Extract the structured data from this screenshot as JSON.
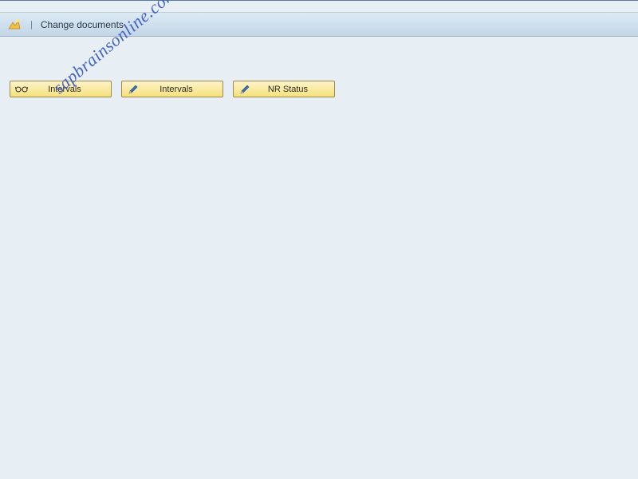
{
  "toolbar": {
    "title": "Change documents"
  },
  "buttons": {
    "display_intervals": {
      "label": "Intervals"
    },
    "change_intervals": {
      "label": "Intervals"
    },
    "nr_status": {
      "label": "NR Status"
    }
  },
  "watermark": "sapbrainsonline.com"
}
